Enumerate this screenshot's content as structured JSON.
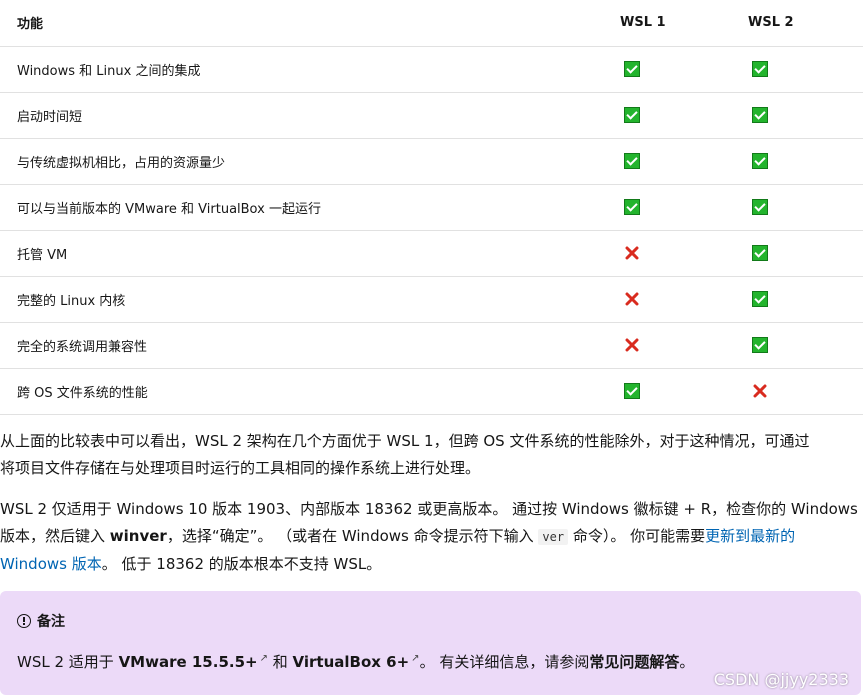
{
  "table": {
    "headers": [
      "功能",
      "WSL 1",
      "WSL 2"
    ],
    "rows": [
      {
        "feature": "Windows 和 Linux 之间的集成",
        "wsl1": "check",
        "wsl2": "check"
      },
      {
        "feature": "启动时间短",
        "wsl1": "check",
        "wsl2": "check"
      },
      {
        "feature": "与传统虚拟机相比，占用的资源量少",
        "wsl1": "check",
        "wsl2": "check"
      },
      {
        "feature": "可以与当前版本的 VMware 和 VirtualBox 一起运行",
        "wsl1": "check",
        "wsl2": "check"
      },
      {
        "feature": "托管 VM",
        "wsl1": "cross",
        "wsl2": "check"
      },
      {
        "feature": "完整的 Linux 内核",
        "wsl1": "cross",
        "wsl2": "check"
      },
      {
        "feature": "完全的系统调用兼容性",
        "wsl1": "cross",
        "wsl2": "check"
      },
      {
        "feature": "跨 OS 文件系统的性能",
        "wsl1": "check",
        "wsl2": "cross"
      }
    ]
  },
  "icons": {
    "check": "check-mark-icon",
    "cross": "cross-mark-icon",
    "note": "info-circle-icon",
    "external": "external-link-icon"
  },
  "colors": {
    "check": "#23b42d",
    "cross": "#d92b1f",
    "link": "#0065b3",
    "note_bg": "#ecdaf8"
  },
  "para1": {
    "line1": "从上面的比较表中可以看出，WSL 2 架构在几个方面优于 WSL 1，但跨 OS 文件系统的性能除外，对于这种情况，可通过",
    "line2": "将项目文件存储在与处理项目时运行的工具相同的操作系统上进行处理。"
  },
  "para2": {
    "line1": "WSL 2 仅适用于 Windows 10 版本 1903、内部版本 18362 或更高版本。 通过按 Windows 徽标键 + R，检查你的 Windows",
    "line2_a": "版本，然后键入 ",
    "line2_bold": "winver",
    "line2_b": "，选择“确定”。 （或者在 Windows 命令提示符下输入 ",
    "line2_code": "ver",
    "line2_c": " 命令）。 你可能需要",
    "link_part1": "更新到最新的",
    "link_part2": "Windows 版本",
    "line3_rest": "。 低于 18362 的版本根本不支持 WSL。"
  },
  "note": {
    "title": "备注",
    "body_a": "WSL 2 适用于 ",
    "vmware": "VMware 15.5.5+",
    "body_b": " 和 ",
    "virtualbox": "VirtualBox 6+",
    "body_c": "。 有关详细信息，请参阅",
    "faq": "常见问题解答",
    "body_d": "。"
  },
  "watermark": "CSDN @jjyy2333"
}
